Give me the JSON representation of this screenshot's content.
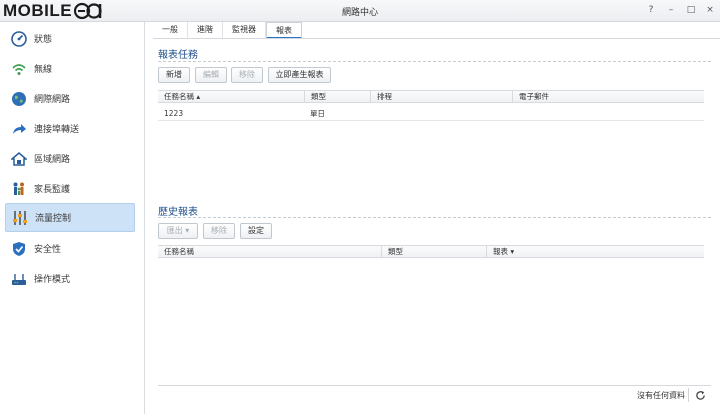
{
  "logo": {
    "text": "MOBILE",
    "suffix": "01"
  },
  "window": {
    "title": "網路中心",
    "help": "?",
    "minimize": "–",
    "maximize": "□",
    "close": "×"
  },
  "sidebar": {
    "items": [
      {
        "label": "狀態",
        "icon": "gauge-icon"
      },
      {
        "label": "無線",
        "icon": "wifi-icon"
      },
      {
        "label": "網際網路",
        "icon": "globe-icon"
      },
      {
        "label": "連接埠轉送",
        "icon": "forward-arrow-icon"
      },
      {
        "label": "區域網路",
        "icon": "home-network-icon"
      },
      {
        "label": "家長監護",
        "icon": "family-icon"
      },
      {
        "label": "流量控制",
        "icon": "sliders-icon",
        "active": true
      },
      {
        "label": "安全性",
        "icon": "shield-icon"
      },
      {
        "label": "操作模式",
        "icon": "router-icon"
      }
    ]
  },
  "tabs": [
    "一般",
    "進階",
    "監視器",
    "報表"
  ],
  "active_tab": "報表",
  "report_tasks": {
    "title": "報表任務",
    "buttons": {
      "add": "新增",
      "edit": "編輯",
      "remove": "移除",
      "generate": "立即產生報表"
    },
    "columns": [
      "任務名稱 ▴",
      "類型",
      "排程",
      "電子郵件"
    ],
    "rows": [
      [
        "1223",
        "單日",
        "",
        ""
      ]
    ]
  },
  "history": {
    "title": "歷史報表",
    "buttons": {
      "export": "匯出 ▾",
      "remove": "移除",
      "settings": "設定"
    },
    "columns": [
      "任務名稱",
      "類型",
      "報表 ▾"
    ]
  },
  "status": {
    "text": "沒有任何資料"
  },
  "colors": {
    "accent": "#2a73c6",
    "active_bg": "#cde2f7",
    "section_title": "#1e4f8a"
  }
}
